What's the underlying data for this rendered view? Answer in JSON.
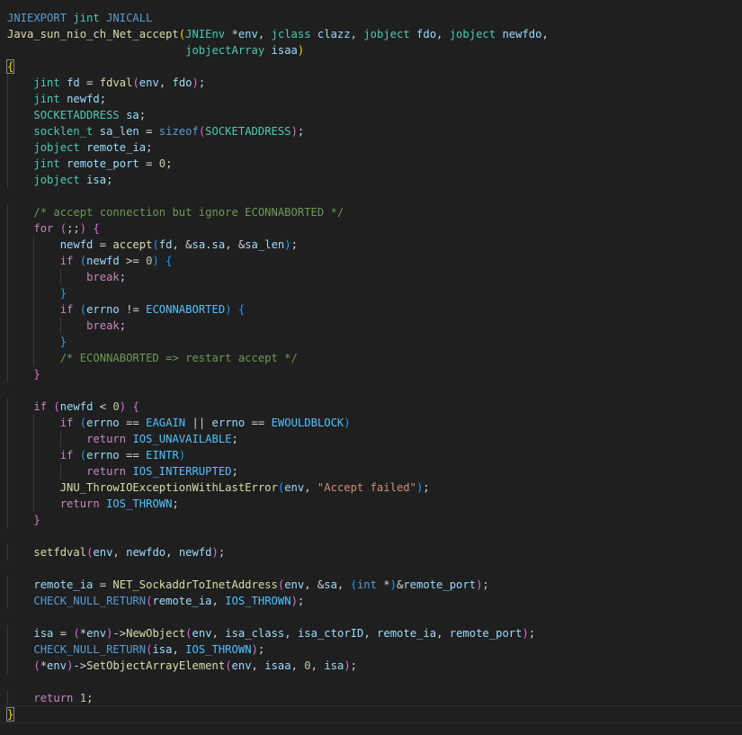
{
  "editor": {
    "theme_colors": {
      "background": "#1f1f1f",
      "keyword": "#569cd6",
      "control": "#c586c0",
      "type": "#4ec9b0",
      "function": "#dcdcaa",
      "variable": "#9cdcfe",
      "constant": "#4fc1ff",
      "number": "#b5cea8",
      "string": "#ce9178",
      "comment": "#6a9955"
    },
    "lines": [
      [
        [
          "tk-macro",
          "JNIEXPORT "
        ],
        [
          "tk-type",
          "jint"
        ],
        [
          "tk-macro",
          " JNICALL"
        ]
      ],
      [
        [
          "tk-fn",
          "Java_sun_nio_ch_Net_accept"
        ],
        [
          "tk-b1",
          "("
        ],
        [
          "tk-type",
          "JNIEnv"
        ],
        [
          "tk-op",
          " *"
        ],
        [
          "tk-var",
          "env"
        ],
        [
          "tk-op",
          ", "
        ],
        [
          "tk-type",
          "jclass"
        ],
        [
          "tk-op",
          " "
        ],
        [
          "tk-var",
          "clazz"
        ],
        [
          "tk-op",
          ", "
        ],
        [
          "tk-type",
          "jobject"
        ],
        [
          "tk-op",
          " "
        ],
        [
          "tk-var",
          "fdo"
        ],
        [
          "tk-op",
          ", "
        ],
        [
          "tk-type",
          "jobject"
        ],
        [
          "tk-op",
          " "
        ],
        [
          "tk-var",
          "newfdo"
        ],
        [
          "tk-op",
          ","
        ]
      ],
      [
        [
          "tk-op",
          "                           "
        ],
        [
          "tk-type",
          "jobjectArray"
        ],
        [
          "tk-op",
          " "
        ],
        [
          "tk-var",
          "isaa"
        ],
        [
          "tk-b1",
          ")"
        ]
      ],
      [
        [
          "tk-b1",
          "{"
        ]
      ],
      [
        [
          "tk-op",
          "    "
        ],
        [
          "tk-type",
          "jint"
        ],
        [
          "tk-op",
          " "
        ],
        [
          "tk-var",
          "fd"
        ],
        [
          "tk-op",
          " = "
        ],
        [
          "tk-fn",
          "fdval"
        ],
        [
          "tk-b2",
          "("
        ],
        [
          "tk-var",
          "env"
        ],
        [
          "tk-op",
          ", "
        ],
        [
          "tk-var",
          "fdo"
        ],
        [
          "tk-b2",
          ")"
        ],
        [
          "tk-op",
          ";"
        ]
      ],
      [
        [
          "tk-op",
          "    "
        ],
        [
          "tk-type",
          "jint"
        ],
        [
          "tk-op",
          " "
        ],
        [
          "tk-var",
          "newfd"
        ],
        [
          "tk-op",
          ";"
        ]
      ],
      [
        [
          "tk-op",
          "    "
        ],
        [
          "tk-type",
          "SOCKETADDRESS"
        ],
        [
          "tk-op",
          " "
        ],
        [
          "tk-var",
          "sa"
        ],
        [
          "tk-op",
          ";"
        ]
      ],
      [
        [
          "tk-op",
          "    "
        ],
        [
          "tk-type",
          "socklen_t"
        ],
        [
          "tk-op",
          " "
        ],
        [
          "tk-var",
          "sa_len"
        ],
        [
          "tk-op",
          " = "
        ],
        [
          "tk-kw",
          "sizeof"
        ],
        [
          "tk-b2",
          "("
        ],
        [
          "tk-type",
          "SOCKETADDRESS"
        ],
        [
          "tk-b2",
          ")"
        ],
        [
          "tk-op",
          ";"
        ]
      ],
      [
        [
          "tk-op",
          "    "
        ],
        [
          "tk-type",
          "jobject"
        ],
        [
          "tk-op",
          " "
        ],
        [
          "tk-var",
          "remote_ia"
        ],
        [
          "tk-op",
          ";"
        ]
      ],
      [
        [
          "tk-op",
          "    "
        ],
        [
          "tk-type",
          "jint"
        ],
        [
          "tk-op",
          " "
        ],
        [
          "tk-var",
          "remote_port"
        ],
        [
          "tk-op",
          " = "
        ],
        [
          "tk-num",
          "0"
        ],
        [
          "tk-op",
          ";"
        ]
      ],
      [
        [
          "tk-op",
          "    "
        ],
        [
          "tk-type",
          "jobject"
        ],
        [
          "tk-op",
          " "
        ],
        [
          "tk-var",
          "isa"
        ],
        [
          "tk-op",
          ";"
        ]
      ],
      [],
      [
        [
          "tk-op",
          "    "
        ],
        [
          "tk-com",
          "/* accept connection but ignore ECONNABORTED */"
        ]
      ],
      [
        [
          "tk-op",
          "    "
        ],
        [
          "tk-ctrl",
          "for"
        ],
        [
          "tk-op",
          " "
        ],
        [
          "tk-b2",
          "("
        ],
        [
          "tk-op",
          ";;"
        ],
        [
          "tk-b2",
          ")"
        ],
        [
          "tk-op",
          " "
        ],
        [
          "tk-b2",
          "{"
        ]
      ],
      [
        [
          "tk-op",
          "        "
        ],
        [
          "tk-var",
          "newfd"
        ],
        [
          "tk-op",
          " = "
        ],
        [
          "tk-fn",
          "accept"
        ],
        [
          "tk-b3",
          "("
        ],
        [
          "tk-var",
          "fd"
        ],
        [
          "tk-op",
          ", &"
        ],
        [
          "tk-var",
          "sa"
        ],
        [
          "tk-op",
          "."
        ],
        [
          "tk-var",
          "sa"
        ],
        [
          "tk-op",
          ", &"
        ],
        [
          "tk-var",
          "sa_len"
        ],
        [
          "tk-b3",
          ")"
        ],
        [
          "tk-op",
          ";"
        ]
      ],
      [
        [
          "tk-op",
          "        "
        ],
        [
          "tk-ctrl",
          "if"
        ],
        [
          "tk-op",
          " "
        ],
        [
          "tk-b3",
          "("
        ],
        [
          "tk-var",
          "newfd"
        ],
        [
          "tk-op",
          " >= "
        ],
        [
          "tk-num",
          "0"
        ],
        [
          "tk-b3",
          ")"
        ],
        [
          "tk-op",
          " "
        ],
        [
          "tk-b3",
          "{"
        ]
      ],
      [
        [
          "tk-op",
          "            "
        ],
        [
          "tk-ctrl",
          "break"
        ],
        [
          "tk-op",
          ";"
        ]
      ],
      [
        [
          "tk-op",
          "        "
        ],
        [
          "tk-b3",
          "}"
        ]
      ],
      [
        [
          "tk-op",
          "        "
        ],
        [
          "tk-ctrl",
          "if"
        ],
        [
          "tk-op",
          " "
        ],
        [
          "tk-b3",
          "("
        ],
        [
          "tk-var",
          "errno"
        ],
        [
          "tk-op",
          " != "
        ],
        [
          "tk-const",
          "ECONNABORTED"
        ],
        [
          "tk-b3",
          ")"
        ],
        [
          "tk-op",
          " "
        ],
        [
          "tk-b3",
          "{"
        ]
      ],
      [
        [
          "tk-op",
          "            "
        ],
        [
          "tk-ctrl",
          "break"
        ],
        [
          "tk-op",
          ";"
        ]
      ],
      [
        [
          "tk-op",
          "        "
        ],
        [
          "tk-b3",
          "}"
        ]
      ],
      [
        [
          "tk-op",
          "        "
        ],
        [
          "tk-com",
          "/* ECONNABORTED => restart accept */"
        ]
      ],
      [
        [
          "tk-op",
          "    "
        ],
        [
          "tk-b2",
          "}"
        ]
      ],
      [],
      [
        [
          "tk-op",
          "    "
        ],
        [
          "tk-ctrl",
          "if"
        ],
        [
          "tk-op",
          " "
        ],
        [
          "tk-b2",
          "("
        ],
        [
          "tk-var",
          "newfd"
        ],
        [
          "tk-op",
          " < "
        ],
        [
          "tk-num",
          "0"
        ],
        [
          "tk-b2",
          ")"
        ],
        [
          "tk-op",
          " "
        ],
        [
          "tk-b2",
          "{"
        ]
      ],
      [
        [
          "tk-op",
          "        "
        ],
        [
          "tk-ctrl",
          "if"
        ],
        [
          "tk-op",
          " "
        ],
        [
          "tk-b3",
          "("
        ],
        [
          "tk-var",
          "errno"
        ],
        [
          "tk-op",
          " == "
        ],
        [
          "tk-const",
          "EAGAIN"
        ],
        [
          "tk-op",
          " || "
        ],
        [
          "tk-var",
          "errno"
        ],
        [
          "tk-op",
          " == "
        ],
        [
          "tk-const",
          "EWOULDBLOCK"
        ],
        [
          "tk-b3",
          ")"
        ]
      ],
      [
        [
          "tk-op",
          "            "
        ],
        [
          "tk-ctrl",
          "return"
        ],
        [
          "tk-op",
          " "
        ],
        [
          "tk-const",
          "IOS_UNAVAILABLE"
        ],
        [
          "tk-op",
          ";"
        ]
      ],
      [
        [
          "tk-op",
          "        "
        ],
        [
          "tk-ctrl",
          "if"
        ],
        [
          "tk-op",
          " "
        ],
        [
          "tk-b3",
          "("
        ],
        [
          "tk-var",
          "errno"
        ],
        [
          "tk-op",
          " == "
        ],
        [
          "tk-const",
          "EINTR"
        ],
        [
          "tk-b3",
          ")"
        ]
      ],
      [
        [
          "tk-op",
          "            "
        ],
        [
          "tk-ctrl",
          "return"
        ],
        [
          "tk-op",
          " "
        ],
        [
          "tk-const",
          "IOS_INTERRUPTED"
        ],
        [
          "tk-op",
          ";"
        ]
      ],
      [
        [
          "tk-op",
          "        "
        ],
        [
          "tk-fn",
          "JNU_ThrowIOExceptionWithLastError"
        ],
        [
          "tk-b3",
          "("
        ],
        [
          "tk-var",
          "env"
        ],
        [
          "tk-op",
          ", "
        ],
        [
          "tk-str",
          "\"Accept failed\""
        ],
        [
          "tk-b3",
          ")"
        ],
        [
          "tk-op",
          ";"
        ]
      ],
      [
        [
          "tk-op",
          "        "
        ],
        [
          "tk-ctrl",
          "return"
        ],
        [
          "tk-op",
          " "
        ],
        [
          "tk-const",
          "IOS_THROWN"
        ],
        [
          "tk-op",
          ";"
        ]
      ],
      [
        [
          "tk-op",
          "    "
        ],
        [
          "tk-b2",
          "}"
        ]
      ],
      [],
      [
        [
          "tk-op",
          "    "
        ],
        [
          "tk-fn",
          "setfdval"
        ],
        [
          "tk-b2",
          "("
        ],
        [
          "tk-var",
          "env"
        ],
        [
          "tk-op",
          ", "
        ],
        [
          "tk-var",
          "newfdo"
        ],
        [
          "tk-op",
          ", "
        ],
        [
          "tk-var",
          "newfd"
        ],
        [
          "tk-b2",
          ")"
        ],
        [
          "tk-op",
          ";"
        ]
      ],
      [],
      [
        [
          "tk-op",
          "    "
        ],
        [
          "tk-var",
          "remote_ia"
        ],
        [
          "tk-op",
          " = "
        ],
        [
          "tk-fn",
          "NET_SockaddrToInetAddress"
        ],
        [
          "tk-b2",
          "("
        ],
        [
          "tk-var",
          "env"
        ],
        [
          "tk-op",
          ", &"
        ],
        [
          "tk-var",
          "sa"
        ],
        [
          "tk-op",
          ", "
        ],
        [
          "tk-b3",
          "("
        ],
        [
          "tk-kw",
          "int"
        ],
        [
          "tk-op",
          " *"
        ],
        [
          "tk-b3",
          ")"
        ],
        [
          "tk-op",
          "&"
        ],
        [
          "tk-var",
          "remote_port"
        ],
        [
          "tk-b2",
          ")"
        ],
        [
          "tk-op",
          ";"
        ]
      ],
      [
        [
          "tk-op",
          "    "
        ],
        [
          "tk-macro",
          "CHECK_NULL_RETURN"
        ],
        [
          "tk-b2",
          "("
        ],
        [
          "tk-var",
          "remote_ia"
        ],
        [
          "tk-op",
          ", "
        ],
        [
          "tk-const",
          "IOS_THROWN"
        ],
        [
          "tk-b2",
          ")"
        ],
        [
          "tk-op",
          ";"
        ]
      ],
      [],
      [
        [
          "tk-op",
          "    "
        ],
        [
          "tk-var",
          "isa"
        ],
        [
          "tk-op",
          " = "
        ],
        [
          "tk-b2",
          "("
        ],
        [
          "tk-op",
          "*"
        ],
        [
          "tk-var",
          "env"
        ],
        [
          "tk-b2",
          ")"
        ],
        [
          "tk-op",
          "->"
        ],
        [
          "tk-fn",
          "NewObject"
        ],
        [
          "tk-b2",
          "("
        ],
        [
          "tk-var",
          "env"
        ],
        [
          "tk-op",
          ", "
        ],
        [
          "tk-var",
          "isa_class"
        ],
        [
          "tk-op",
          ", "
        ],
        [
          "tk-var",
          "isa_ctorID"
        ],
        [
          "tk-op",
          ", "
        ],
        [
          "tk-var",
          "remote_ia"
        ],
        [
          "tk-op",
          ", "
        ],
        [
          "tk-var",
          "remote_port"
        ],
        [
          "tk-b2",
          ")"
        ],
        [
          "tk-op",
          ";"
        ]
      ],
      [
        [
          "tk-op",
          "    "
        ],
        [
          "tk-macro",
          "CHECK_NULL_RETURN"
        ],
        [
          "tk-b2",
          "("
        ],
        [
          "tk-var",
          "isa"
        ],
        [
          "tk-op",
          ", "
        ],
        [
          "tk-const",
          "IOS_THROWN"
        ],
        [
          "tk-b2",
          ")"
        ],
        [
          "tk-op",
          ";"
        ]
      ],
      [
        [
          "tk-op",
          "    "
        ],
        [
          "tk-b2",
          "("
        ],
        [
          "tk-op",
          "*"
        ],
        [
          "tk-var",
          "env"
        ],
        [
          "tk-b2",
          ")"
        ],
        [
          "tk-op",
          "->"
        ],
        [
          "tk-fn",
          "SetObjectArrayElement"
        ],
        [
          "tk-b2",
          "("
        ],
        [
          "tk-var",
          "env"
        ],
        [
          "tk-op",
          ", "
        ],
        [
          "tk-var",
          "isaa"
        ],
        [
          "tk-op",
          ", "
        ],
        [
          "tk-num",
          "0"
        ],
        [
          "tk-op",
          ", "
        ],
        [
          "tk-var",
          "isa"
        ],
        [
          "tk-b2",
          ")"
        ],
        [
          "tk-op",
          ";"
        ]
      ],
      [],
      [
        [
          "tk-op",
          "    "
        ],
        [
          "tk-ctrl",
          "return"
        ],
        [
          "tk-op",
          " "
        ],
        [
          "tk-num",
          "1"
        ],
        [
          "tk-op",
          ";"
        ]
      ],
      [
        [
          "tk-b1",
          "}"
        ]
      ]
    ]
  }
}
